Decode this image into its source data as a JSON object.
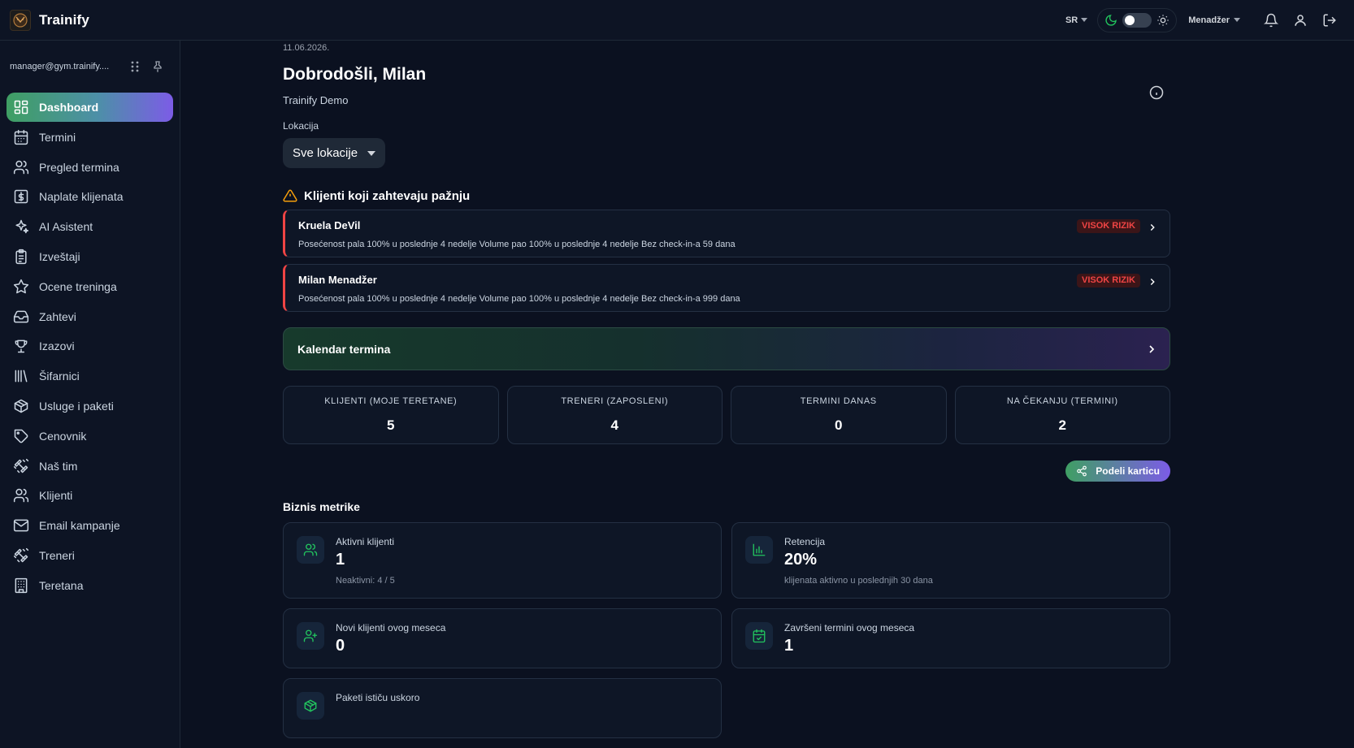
{
  "app": {
    "brand": "Trainify"
  },
  "header": {
    "language": "SR",
    "role": "Menadžer"
  },
  "sidebar": {
    "email": "manager@gym.trainify....",
    "items": [
      {
        "label": "Dashboard",
        "icon": "dashboard-icon",
        "active": true
      },
      {
        "label": "Termini",
        "icon": "calendar-icon"
      },
      {
        "label": "Pregled termina",
        "icon": "users-icon"
      },
      {
        "label": "Naplate klijenata",
        "icon": "dollar-icon"
      },
      {
        "label": "AI Asistent",
        "icon": "sparkles-icon"
      },
      {
        "label": "Izveštaji",
        "icon": "clipboard-icon"
      },
      {
        "label": "Ocene treninga",
        "icon": "star-icon"
      },
      {
        "label": "Zahtevi",
        "icon": "inbox-icon"
      },
      {
        "label": "Izazovi",
        "icon": "trophy-icon"
      },
      {
        "label": "Šifarnici",
        "icon": "library-icon"
      },
      {
        "label": "Usluge i paketi",
        "icon": "package-icon"
      },
      {
        "label": "Cenovnik",
        "icon": "tag-icon"
      },
      {
        "label": "Naš tim",
        "icon": "dumbbell-icon"
      },
      {
        "label": "Klijenti",
        "icon": "users-icon"
      },
      {
        "label": "Email kampanje",
        "icon": "mail-icon"
      },
      {
        "label": "Treneri",
        "icon": "dumbbell-icon"
      },
      {
        "label": "Teretana",
        "icon": "building-icon"
      }
    ]
  },
  "main": {
    "date": "11.06.2026.",
    "welcome": "Dobrodošli, Milan",
    "org": "Trainify Demo",
    "location_label": "Lokacija",
    "location_value": "Sve lokacije",
    "attention_title": "Klijenti koji zahtevaju pažnju",
    "alerts": [
      {
        "name": "Kruela DeVil",
        "desc": "Posećenost pala 100% u poslednje 4 nedelje Volume pao 100% u poslednje 4 nedelje Bez check-in-a 59 dana",
        "badge": "VISOK RIZIK"
      },
      {
        "name": "Milan Menadžer",
        "desc": "Posećenost pala 100% u poslednje 4 nedelje Volume pao 100% u poslednje 4 nedelje Bez check-in-a 999 dana",
        "badge": "VISOK RIZIK"
      }
    ],
    "calendar_label": "Kalendar termina",
    "stats": [
      {
        "label": "KLIJENTI (MOJE TERETANE)",
        "value": "5"
      },
      {
        "label": "TRENERI (ZAPOSLENI)",
        "value": "4"
      },
      {
        "label": "TERMINI DANAS",
        "value": "0"
      },
      {
        "label": "NA ČEKANJU (TERMINI)",
        "value": "2"
      }
    ],
    "share_label": "Podeli karticu",
    "business_title": "Biznis metrike",
    "metrics": [
      {
        "label": "Aktivni klijenti",
        "value": "1",
        "sub": "Neaktivni: 4 / 5",
        "icon": "users-icon"
      },
      {
        "label": "Retencija",
        "value": "20%",
        "sub": "klijenata aktivno u poslednjih 30 dana",
        "icon": "bar-chart-icon"
      },
      {
        "label": "Novi klijenti ovog meseca",
        "value": "0",
        "icon": "user-plus-icon"
      },
      {
        "label": "Završeni termini ovog meseca",
        "value": "1",
        "icon": "calendar-check-icon"
      },
      {
        "label": "Paketi ističu uskoro",
        "icon": "package-icon"
      }
    ]
  },
  "colors": {
    "background": "#0b1120",
    "accent_green": "#3f9f63",
    "accent_purple": "#7c5ce6",
    "risk_red": "#ef4444"
  }
}
